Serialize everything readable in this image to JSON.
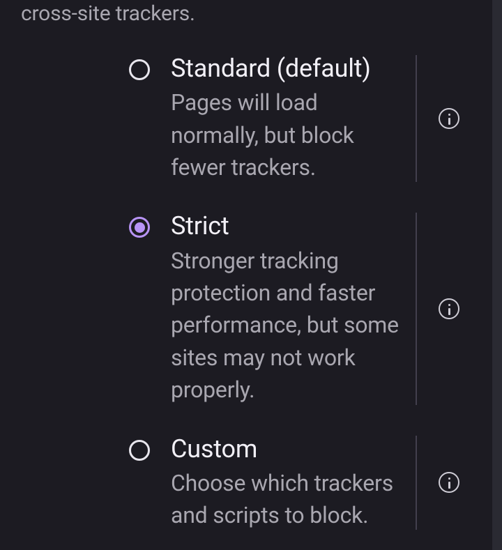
{
  "intro": "cross-site trackers.",
  "options": [
    {
      "id": "standard",
      "title": "Standard (default)",
      "description": "Pages will load normally, but block fewer trackers.",
      "selected": false
    },
    {
      "id": "strict",
      "title": "Strict",
      "description": "Stronger tracking protection and faster performance, but some sites may not work properly.",
      "selected": true
    },
    {
      "id": "custom",
      "title": "Custom",
      "description": "Choose which trackers and scripts to block.",
      "selected": false
    }
  ],
  "colors": {
    "background": "#1c1b22",
    "text_primary": "#f2f0f7",
    "text_secondary": "#a9a7b0",
    "accent": "#b894f6",
    "divider": "#423f4d"
  }
}
